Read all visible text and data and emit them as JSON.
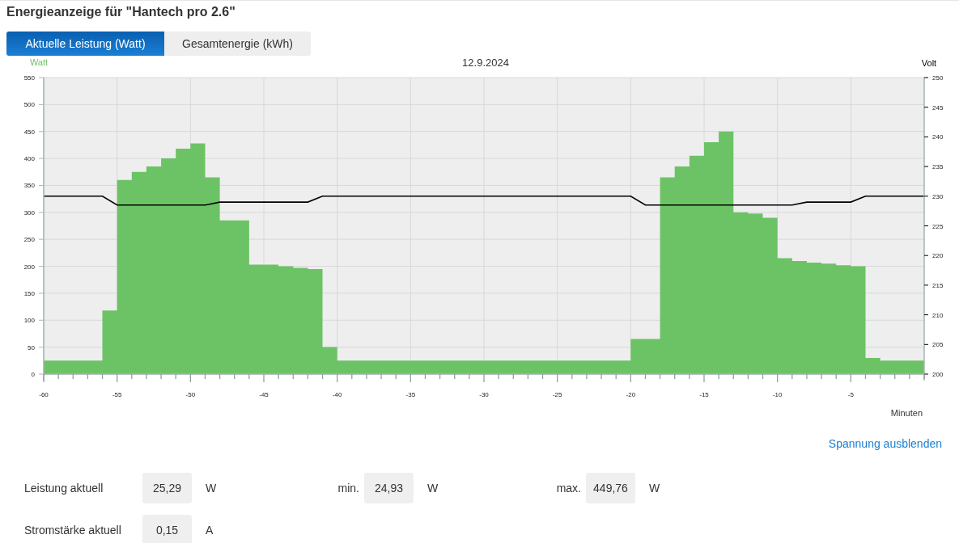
{
  "title": "Energieanzeige für \"Hantech pro 2.6\"",
  "tabs": [
    {
      "label": "Aktuelle Leistung (Watt)",
      "selected": true
    },
    {
      "label": "Gesamtenergie (kWh)",
      "selected": false
    }
  ],
  "chart_data": {
    "type": "area",
    "title": "12.9.2024",
    "xlabel": "Minuten",
    "x": [
      -60,
      -59,
      -58,
      -57,
      -56,
      -55,
      -54,
      -53,
      -52,
      -51,
      -50,
      -49,
      -48,
      -47,
      -46,
      -45,
      -44,
      -43,
      -42,
      -41,
      -40,
      -39,
      -38,
      -37,
      -36,
      -35,
      -34,
      -33,
      -32,
      -31,
      -30,
      -29,
      -28,
      -27,
      -26,
      -25,
      -24,
      -23,
      -22,
      -21,
      -20,
      -19,
      -18,
      -17,
      -16,
      -15,
      -14,
      -13,
      -12,
      -11,
      -10,
      -9,
      -8,
      -7,
      -6,
      -5,
      -4,
      -3,
      -2,
      -1,
      0
    ],
    "grid": true,
    "xlim": [
      -60,
      0
    ],
    "ylim": [
      0,
      550
    ],
    "y2lim": [
      200,
      250
    ],
    "xticks": [
      -60,
      -55,
      -50,
      -45,
      -40,
      -35,
      -30,
      -25,
      -20,
      -15,
      -10,
      -5
    ],
    "yticks": [
      0,
      50,
      100,
      150,
      200,
      250,
      300,
      350,
      400,
      450,
      500,
      550
    ],
    "y2ticks": [
      200,
      205,
      210,
      215,
      220,
      225,
      230,
      235,
      240,
      245,
      250
    ],
    "series": [
      {
        "name": "Watt",
        "color": "#6cc365",
        "values": [
          25,
          25,
          25,
          25,
          118,
          360,
          375,
          385,
          400,
          418,
          428,
          365,
          285,
          285,
          203,
          203,
          200,
          197,
          195,
          50,
          25,
          25,
          25,
          25,
          25,
          25,
          25,
          25,
          25,
          25,
          25,
          25,
          25,
          25,
          25,
          25,
          25,
          25,
          25,
          25,
          65,
          65,
          365,
          385,
          405,
          430,
          450,
          300,
          298,
          290,
          215,
          210,
          207,
          205,
          202,
          200,
          30,
          25,
          25,
          25,
          25
        ]
      },
      {
        "name": "Volt",
        "color": "#000000",
        "type": "line",
        "axis": "y2",
        "values": [
          230,
          230,
          230,
          230,
          230,
          228.5,
          228.5,
          228.5,
          228.5,
          228.5,
          228.5,
          228.5,
          229,
          229,
          229,
          229,
          229,
          229,
          229,
          230,
          230,
          230,
          230,
          230,
          230,
          230,
          230,
          230,
          230,
          230,
          230,
          230,
          230,
          230,
          230,
          230,
          230,
          230,
          230,
          230,
          230,
          228.5,
          228.5,
          228.5,
          228.5,
          228.5,
          228.5,
          228.5,
          228.5,
          228.5,
          228.5,
          228.5,
          229,
          229,
          229,
          229,
          230,
          230,
          230,
          230,
          230
        ]
      }
    ]
  },
  "toggle_link": "Spannung ausblenden",
  "stats": [
    {
      "label": "Leistung aktuell",
      "value": "25,29",
      "unit": "W",
      "extras": [
        {
          "label": "min.",
          "value": "24,93",
          "unit": "W"
        },
        {
          "label": "max.",
          "value": "449,76",
          "unit": "W"
        }
      ]
    },
    {
      "label": "Stromstärke aktuell",
      "value": "0,15",
      "unit": "A"
    }
  ]
}
